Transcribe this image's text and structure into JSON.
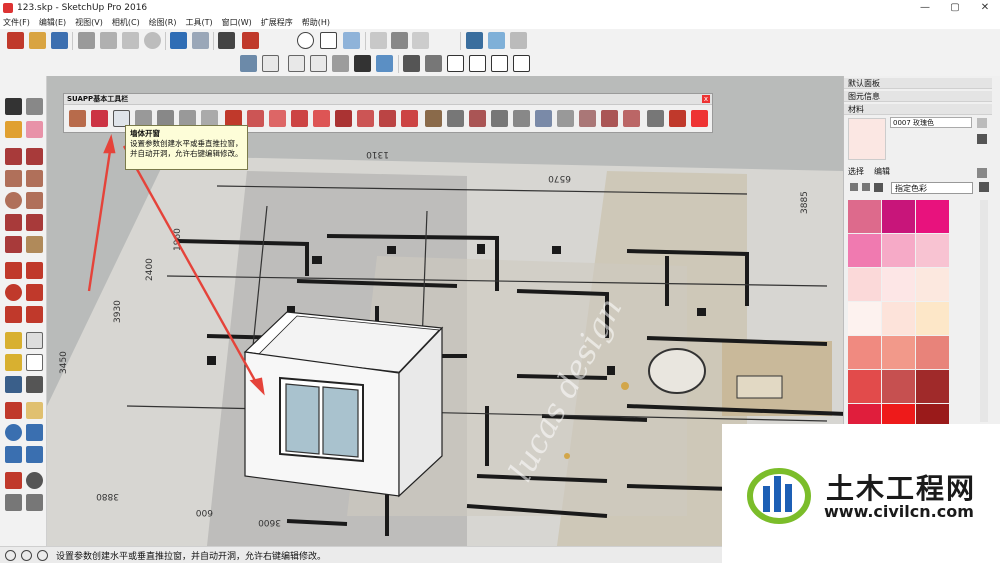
{
  "window": {
    "title": "123.skp - SketchUp Pro 2016",
    "minimize": "—",
    "maximize": "▢",
    "close": "✕"
  },
  "menu": [
    "文件(F)",
    "编辑(E)",
    "视图(V)",
    "相机(C)",
    "绘图(R)",
    "工具(T)",
    "窗口(W)",
    "扩展程序",
    "帮助(H)"
  ],
  "suapp_toolbar": {
    "title": "SUAPP基本工具栏",
    "close": "x"
  },
  "tooltip": {
    "title": "墙体开窗",
    "body": "设置参数创建水平或垂直推拉窗，并自动开洞，允许右键编辑修改。"
  },
  "plan_dimensions": [
    "1310",
    "6570",
    "3885",
    "1960",
    "2400",
    "3930",
    "3450",
    "3880",
    "3600",
    "600"
  ],
  "plan_watermark": "lucas design",
  "tray": {
    "title": "默认面板",
    "section_entity": "图元信息",
    "section_materials": "材料",
    "material_name": "0007 玫瑰色",
    "tab_select": "选择",
    "tab_edit": "编辑",
    "collection": "指定色彩",
    "swatches": [
      "#dd6a8c",
      "#c8157a",
      "#e8127d",
      "#f07ab0",
      "#f6aac7",
      "#f8c3d2",
      "#fbd9d9",
      "#fde6e6",
      "#fce8df",
      "#fdf2ef",
      "#fde3da",
      "#fde7c8",
      "#f08a80",
      "#f2998a",
      "#e8837a",
      "#e24b4b",
      "#c65050",
      "#a02a2a",
      "#e01e3c",
      "#ee1a1a",
      "#9a1a1a"
    ]
  },
  "status": {
    "text": "设置参数创建水平或垂直推拉窗，并自动开洞，允许右键编辑修改。"
  },
  "watermark": {
    "cn": "土木工程网",
    "url": "www.civilcn.com"
  },
  "colors": {
    "accent_red": "#e5433a",
    "logo_blue": "#1d5fb5",
    "logo_green": "#7bbd2a"
  }
}
